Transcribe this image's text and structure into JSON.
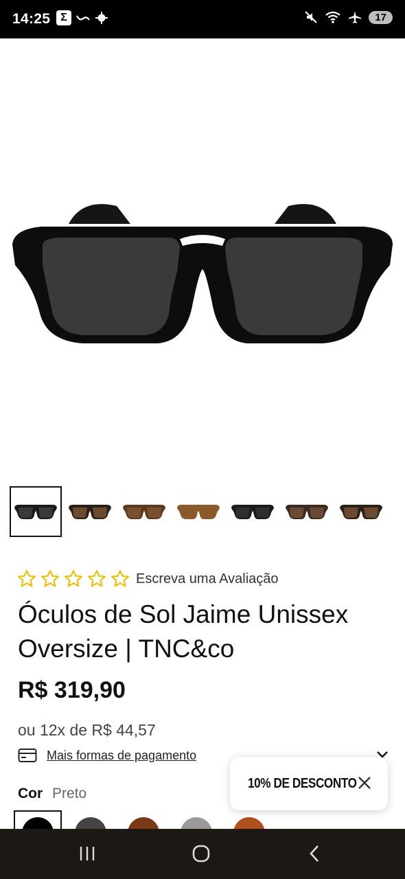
{
  "status_bar": {
    "time": "14:25",
    "sigma": "Σ",
    "battery": "17",
    "icons": [
      "sigma-icon",
      "tilde-icon",
      "settings-gear-icon",
      "mute-icon",
      "wifi-icon",
      "airplane-icon",
      "battery-icon"
    ]
  },
  "product": {
    "rating_stars": 5,
    "rating_filled": 0,
    "rating_link": "Escreva uma Avaliação",
    "title": "Óculos de Sol Jaime Unissex Oversize | TNC&co",
    "price": "R$ 319,90",
    "installments": "ou 12x de R$ 44,57",
    "payment_link": "Mais formas de pagamento",
    "color_label": "Cor",
    "color_value": "Preto"
  },
  "thumbnails": [
    {
      "color": "#1a1a1a",
      "lens": "#3a3a3a"
    },
    {
      "color": "#2a1f18",
      "lens": "#6b4a2e"
    },
    {
      "color": "#5a3a20",
      "lens": "#7a5030"
    },
    {
      "color": "#8a5a2a",
      "lens": "#8a5a2a"
    },
    {
      "color": "#1a1a1a",
      "lens": "#2e2e2e"
    },
    {
      "color": "#3a2a20",
      "lens": "#6a4a35"
    },
    {
      "color": "#2a2016",
      "lens": "#6a4a30"
    }
  ],
  "swatches": [
    "#000000",
    "#444444",
    "#7a3a16",
    "#9a9a9a",
    "#b0501e"
  ],
  "discount": {
    "text": "10% DE DESCONTO"
  },
  "colors": {
    "star_outline": "#e8c21a",
    "nav_bg": "#1e1814"
  }
}
